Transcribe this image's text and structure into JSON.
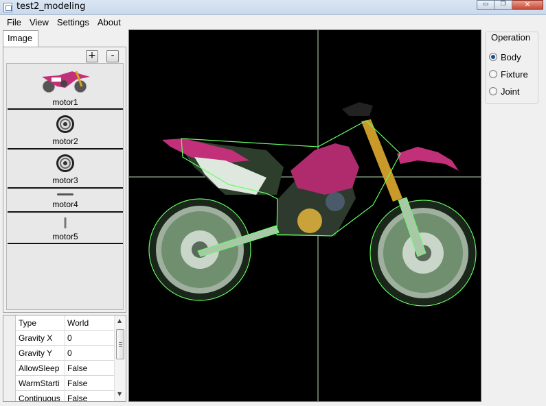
{
  "window": {
    "title": "test2_modeling",
    "buttons": {
      "minimize": "▭",
      "maximize": "❐",
      "close": "✕"
    }
  },
  "menu": [
    "File",
    "View",
    "Settings",
    "About"
  ],
  "left_panel": {
    "tab_label": "Image",
    "add_label": "+",
    "remove_label": "-",
    "images": [
      {
        "name": "motor1",
        "icon": "motorbike-icon"
      },
      {
        "name": "motor2",
        "icon": "wheel-icon"
      },
      {
        "name": "motor3",
        "icon": "wheel-icon"
      },
      {
        "name": "motor4",
        "icon": "bar-icon"
      },
      {
        "name": "motor5",
        "icon": "rod-icon"
      }
    ]
  },
  "properties": [
    {
      "key": "Type",
      "value": "World"
    },
    {
      "key": "Gravity X",
      "value": "0"
    },
    {
      "key": "Gravity Y",
      "value": "0"
    },
    {
      "key": "AllowSleep",
      "value": "False"
    },
    {
      "key": "WarmStarti",
      "value": "False"
    },
    {
      "key": "Continuous",
      "value": "False"
    }
  ],
  "operation": {
    "title": "Operation",
    "options": [
      "Body",
      "Fixture",
      "Joint"
    ],
    "selected": "Body"
  },
  "colors": {
    "canvas_bg": "#000000",
    "outline": "#66ff66",
    "bike_pink": "#c2307a",
    "wheel": "#6f8f6f"
  }
}
